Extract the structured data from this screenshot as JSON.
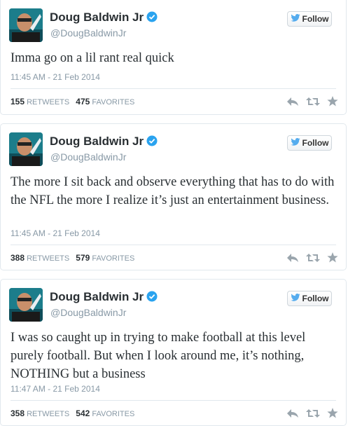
{
  "tweets": [
    {
      "name": "Doug Baldwin Jr",
      "handle": "@DougBaldwinJr",
      "follow_label": "Follow",
      "text": "Imma go on a lil rant real quick",
      "time": "11:45 AM - 21 Feb 2014",
      "retweets": "155",
      "retweets_label": "RETWEETS",
      "favorites": "475",
      "favorites_label": "FAVORITES"
    },
    {
      "name": "Doug Baldwin Jr",
      "handle": "@DougBaldwinJr",
      "follow_label": "Follow",
      "text": "The more I sit back and observe everything that has to do with the NFL the more I realize it’s just an entertainment business.",
      "time": "11:45 AM - 21 Feb 2014",
      "retweets": "388",
      "retweets_label": "RETWEETS",
      "favorites": "579",
      "favorites_label": "FAVORITES"
    },
    {
      "name": "Doug Baldwin Jr",
      "handle": "@DougBaldwinJr",
      "follow_label": "Follow",
      "text": "I was so caught up in trying to make football at this level purely football. But when I look around me, it’s nothing, NOTHING but a business",
      "time": "11:47 AM - 21 Feb 2014",
      "retweets": "358",
      "retweets_label": "RETWEETS",
      "favorites": "542",
      "favorites_label": "FAVORITES"
    }
  ],
  "colors": {
    "verified": "#2aa3ef",
    "twitter_bird": "#55acee",
    "action_icons": "#9aa5ad"
  },
  "icons": [
    "verified-badge-icon",
    "twitter-bird-icon",
    "reply-icon",
    "retweet-icon",
    "favorite-star-icon"
  ]
}
